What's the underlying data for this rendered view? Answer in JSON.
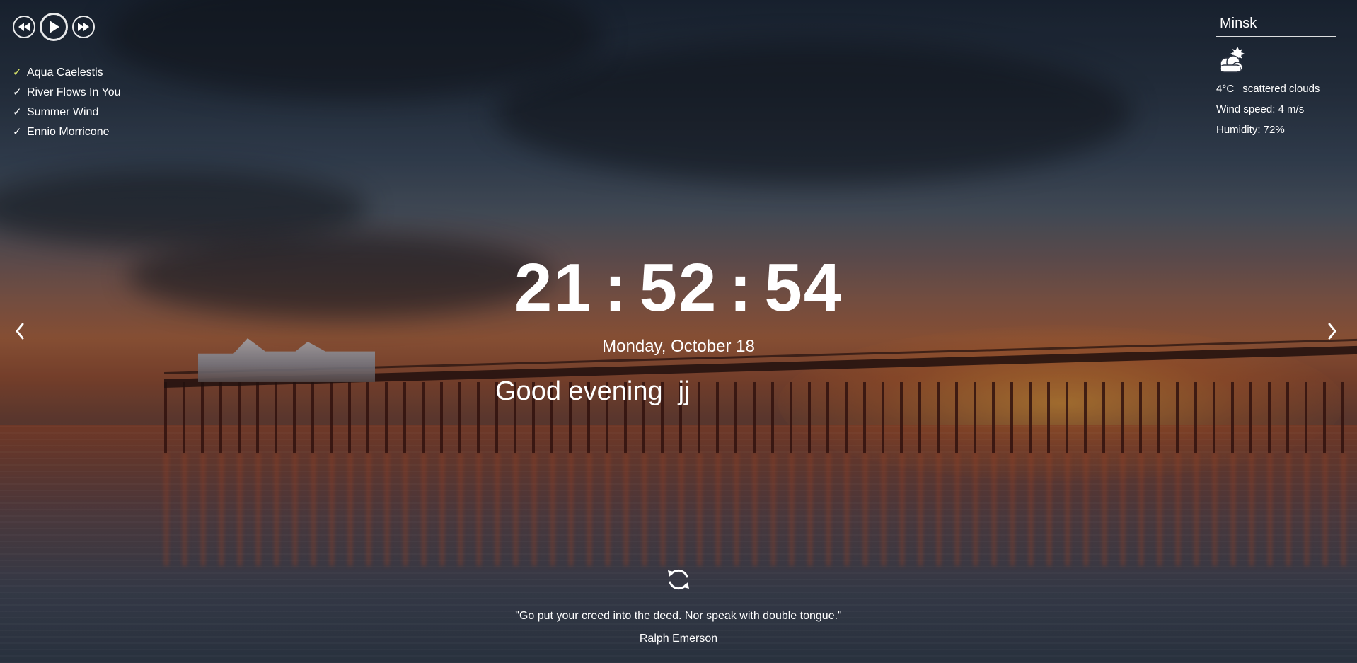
{
  "player": {
    "controls": [
      {
        "name": "rewind-button",
        "icon": "rewind-icon"
      },
      {
        "name": "play-button",
        "icon": "play-icon"
      },
      {
        "name": "fast-forward-button",
        "icon": "fast-forward-icon"
      }
    ],
    "playlist": [
      {
        "title": "Aqua Caelestis",
        "active": true
      },
      {
        "title": "River Flows In You",
        "active": false
      },
      {
        "title": "Summer Wind",
        "active": false
      },
      {
        "title": "Ennio Morricone",
        "active": false
      }
    ],
    "check_symbol": "✓",
    "active_color": "#d8e36a"
  },
  "weather": {
    "city": "Minsk",
    "icon": "cloudy-weather-icon",
    "temperature": "4°C",
    "description": "scattered clouds",
    "wind": "Wind speed: 4 m/s",
    "humidity": "Humidity: 72%"
  },
  "clock": {
    "hours": "21",
    "minutes": "52",
    "seconds": "54",
    "separator": ":"
  },
  "date": "Monday, October 18",
  "greeting": {
    "text": "Good evening",
    "name": "jj"
  },
  "slider": {
    "prev_icon": "chevron-left-icon",
    "next_icon": "chevron-right-icon"
  },
  "quote": {
    "refresh_icon": "refresh-icon",
    "text": "\"Go put your creed into the deed. Nor speak with double tongue.\"",
    "author": "Ralph Emerson"
  }
}
